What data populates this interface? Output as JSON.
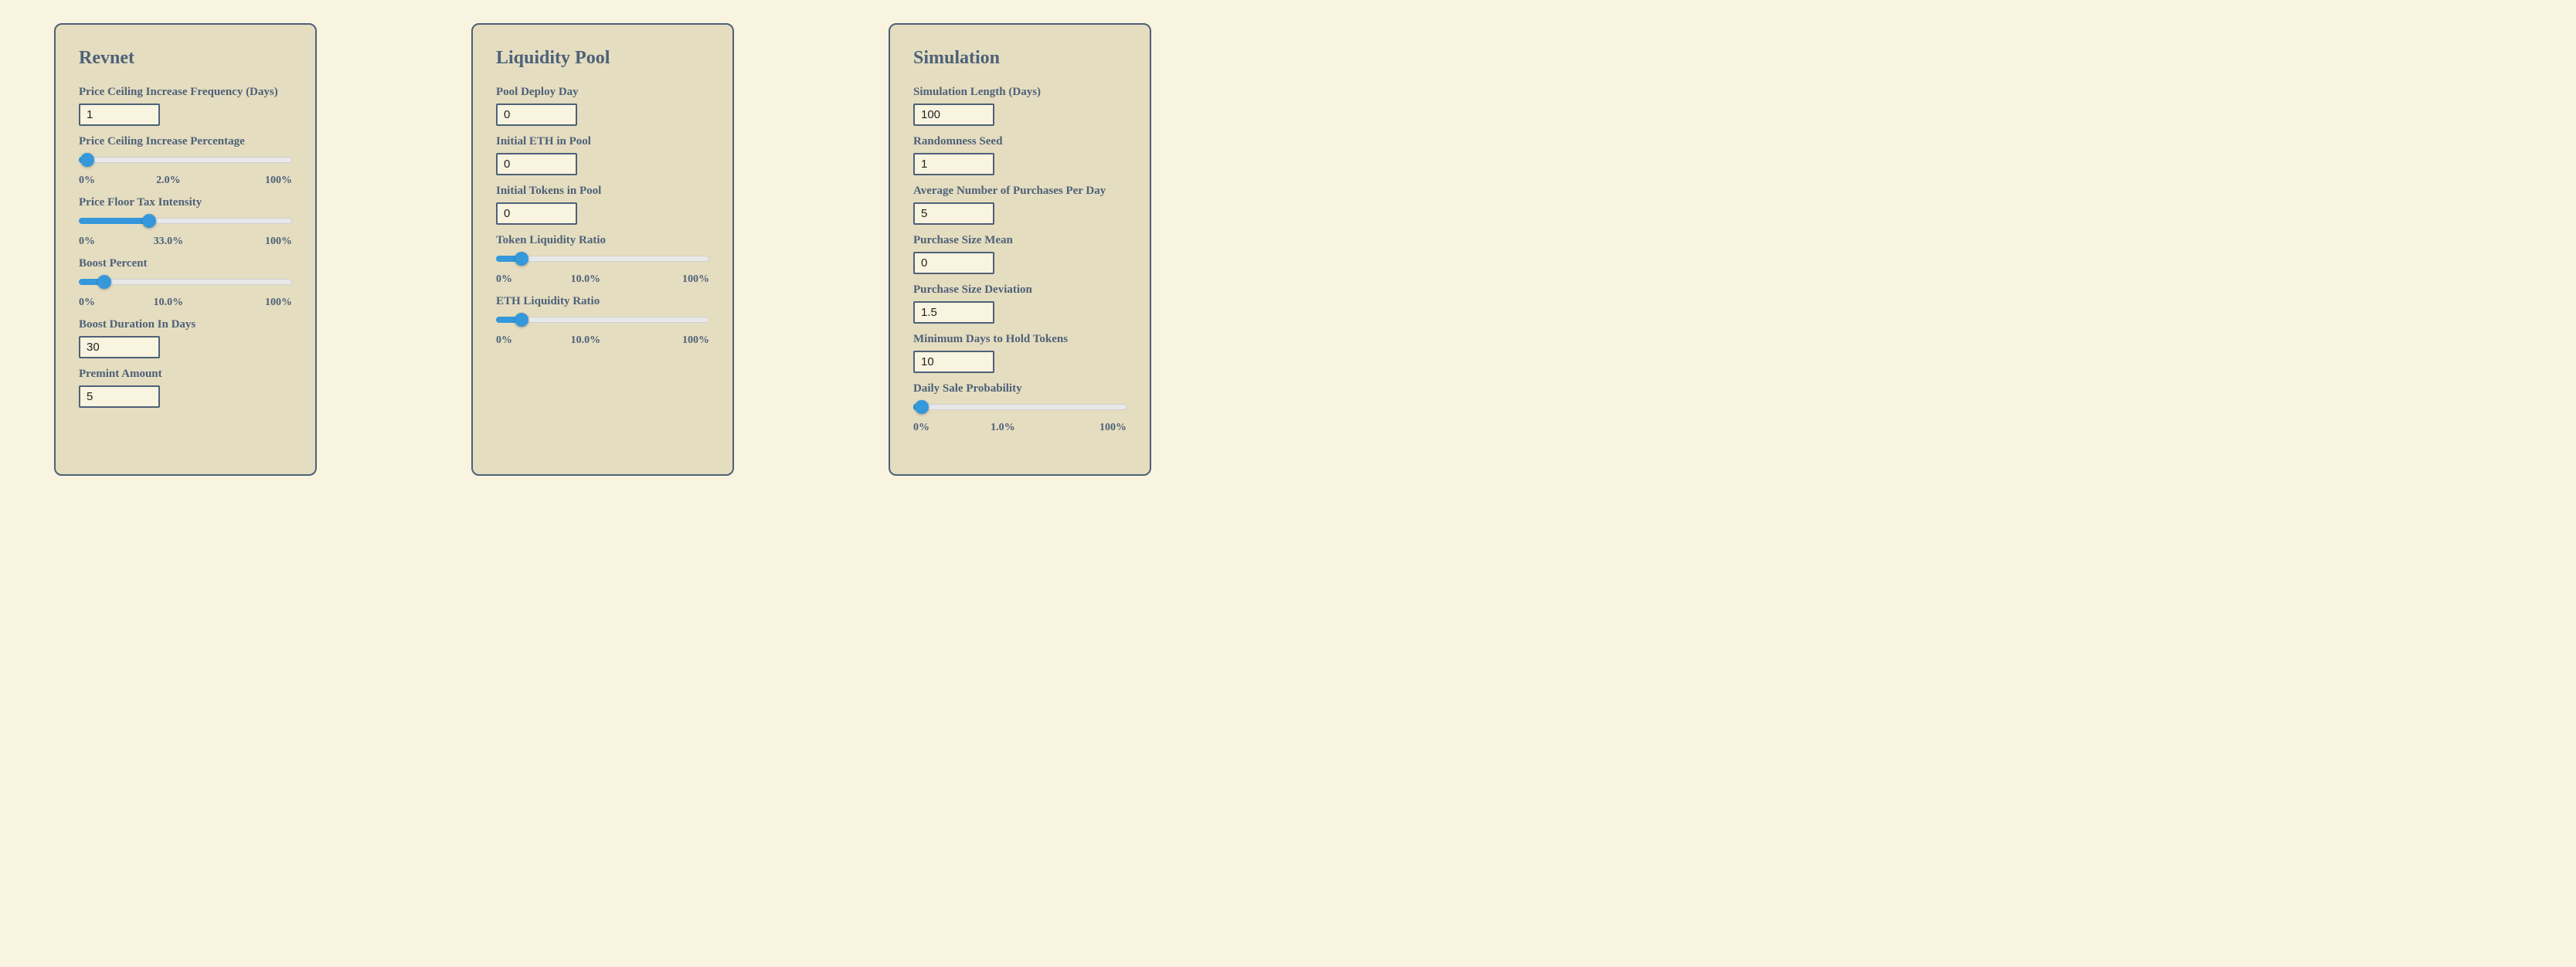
{
  "revnet": {
    "title": "Revnet",
    "priceCeilingFreq": {
      "label": "Price Ceiling Increase Frequency (Days)",
      "value": "1"
    },
    "priceCeilingPct": {
      "label": "Price Ceiling Increase Percentage",
      "min": "0%",
      "mid": "2.0%",
      "max": "100%",
      "value": 2
    },
    "priceFloorTax": {
      "label": "Price Floor Tax Intensity",
      "min": "0%",
      "mid": "33.0%",
      "max": "100%",
      "value": 33
    },
    "boostPercent": {
      "label": "Boost Percent",
      "min": "0%",
      "mid": "10.0%",
      "max": "100%",
      "value": 10
    },
    "boostDuration": {
      "label": "Boost Duration In Days",
      "value": "30"
    },
    "premintAmount": {
      "label": "Premint Amount",
      "value": "5"
    }
  },
  "pool": {
    "title": "Liquidity Pool",
    "deployDay": {
      "label": "Pool Deploy Day",
      "value": "0"
    },
    "initialEth": {
      "label": "Initial ETH in Pool",
      "value": "0"
    },
    "initialTokens": {
      "label": "Initial Tokens in Pool",
      "value": "0"
    },
    "tokenLiquidity": {
      "label": "Token Liquidity Ratio",
      "min": "0%",
      "mid": "10.0%",
      "max": "100%",
      "value": 10
    },
    "ethLiquidity": {
      "label": "ETH Liquidity Ratio",
      "min": "0%",
      "mid": "10.0%",
      "max": "100%",
      "value": 10
    }
  },
  "sim": {
    "title": "Simulation",
    "length": {
      "label": "Simulation Length (Days)",
      "value": "100"
    },
    "seed": {
      "label": "Randomness Seed",
      "value": "1"
    },
    "avgPurchases": {
      "label": "Average Number of Purchases Per Day",
      "value": "5"
    },
    "sizeMean": {
      "label": "Purchase Size Mean",
      "value": "0"
    },
    "sizeDev": {
      "label": "Purchase Size Deviation",
      "value": "1.5"
    },
    "minHold": {
      "label": "Minimum Days to Hold Tokens",
      "value": "10"
    },
    "saleProbability": {
      "label": "Daily Sale Probability",
      "min": "0%",
      "mid": "1.0%",
      "max": "100%",
      "value": 1
    }
  }
}
